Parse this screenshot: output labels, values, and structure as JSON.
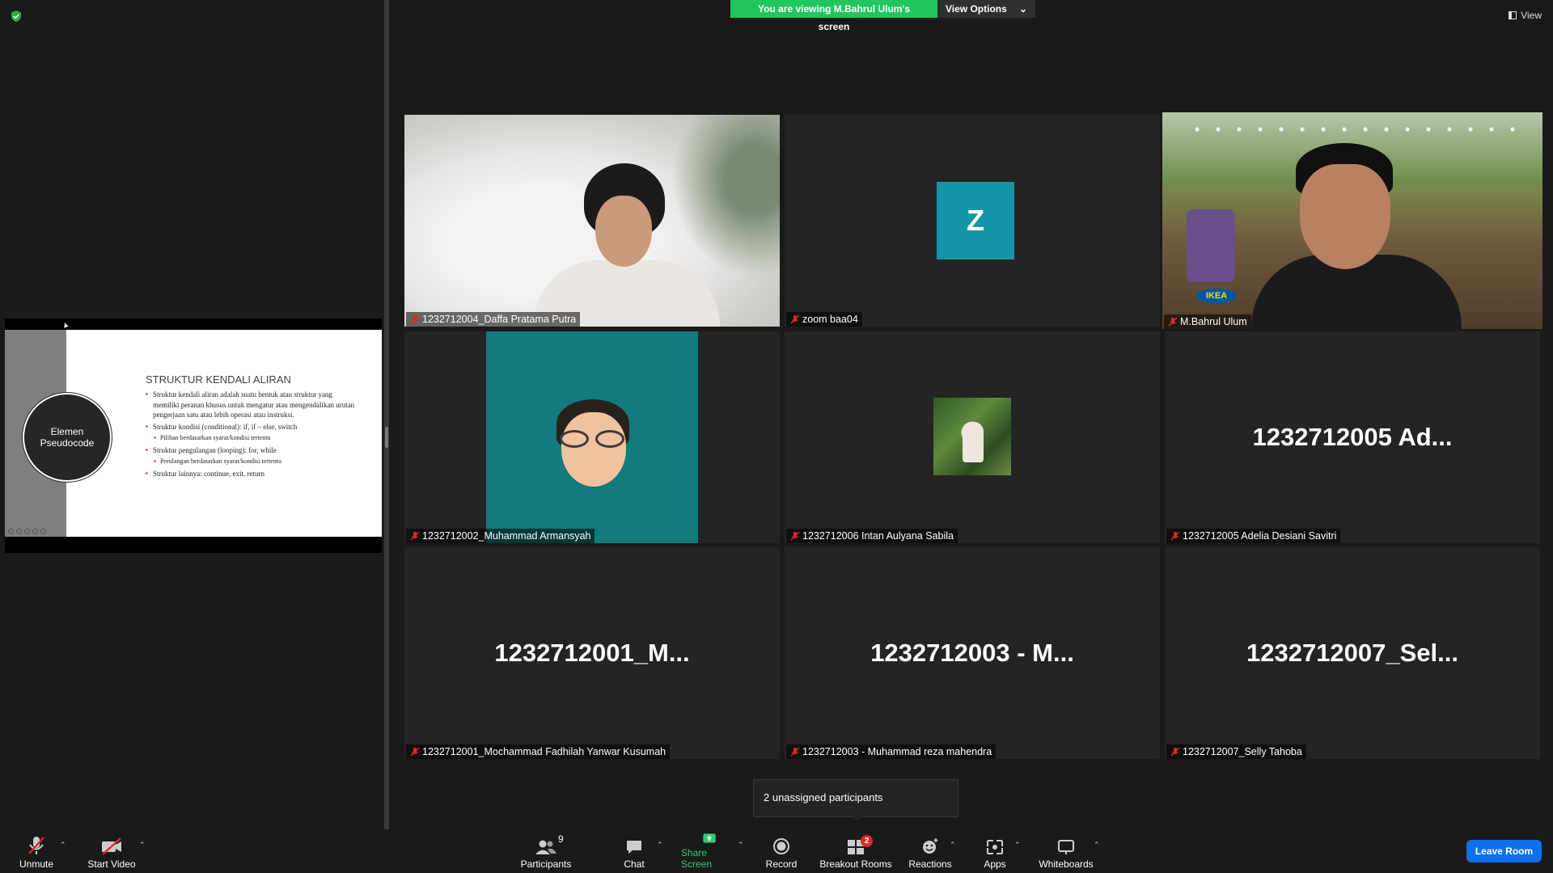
{
  "banner": {
    "viewing_text": "You are viewing M.Bahrul Ulum's screen",
    "view_options_label": "View Options",
    "view_label": "View",
    "banner_color": "#22c55e"
  },
  "shared_slide": {
    "title": "STRUKTUR KENDALI ALIRAN",
    "circle_text_1": "Elemen",
    "circle_text_2": "Pseudocode",
    "bullets": [
      "Struktur kendali aliran adalah suatu bentuk atau struktur yang memiliki peranan khusus untuk mengatur atau mengendalikan urutan pengerjaan satu atau lebih operasi atau instruksi.",
      "Struktur kondisi (conditional): if, if – else, switch",
      "Pilihan berdasarkan syarat/kondisi tertentu",
      "Struktur pengulangan (looping): for, while",
      "Perulangan berdasarkan syarat/kondisi tertentu",
      "Struktur lainnya: continue, exit, return"
    ]
  },
  "tiles": [
    {
      "name": "1232712004_Daffa Pratama Putra"
    },
    {
      "name": "zoom baa04",
      "avatar_letter": "Z",
      "avatar_color": "#1596a6"
    },
    {
      "name": "M.Bahrul Ulum",
      "active_speaker": true,
      "overlay_logo": "IKEA"
    },
    {
      "name": "1232712002_Muhammad Armansyah"
    },
    {
      "name": "1232712006 Intan Aulyana Sabila"
    },
    {
      "name": "1232712005 Adelia Desiani Savitri",
      "big_text": "1232712005  Ad..."
    },
    {
      "name": "1232712001_Mochammad Fadhilah Yanwar Kusumah",
      "big_text": "1232712001_M..."
    },
    {
      "name": "1232712003 - Muhammad reza mahendra",
      "big_text": "1232712003  -  M..."
    },
    {
      "name": "1232712007_Selly Tahoba",
      "big_text": "1232712007_Sel..."
    }
  ],
  "popup": {
    "text": "2 unassigned participants"
  },
  "toolbar": {
    "unmute": "Unmute",
    "start_video": "Start Video",
    "participants": "Participants",
    "participants_count": "9",
    "chat": "Chat",
    "share_screen": "Share Screen",
    "record": "Record",
    "breakout_rooms": "Breakout Rooms",
    "breakout_badge": "2",
    "reactions": "Reactions",
    "apps": "Apps",
    "whiteboards": "Whiteboards",
    "leave_room": "Leave Room",
    "leave_color": "#0e71eb",
    "share_color": "#2ecc71"
  },
  "colors": {
    "active_speaker_border": "#f5e33a",
    "muted_icon": "#e02828"
  }
}
